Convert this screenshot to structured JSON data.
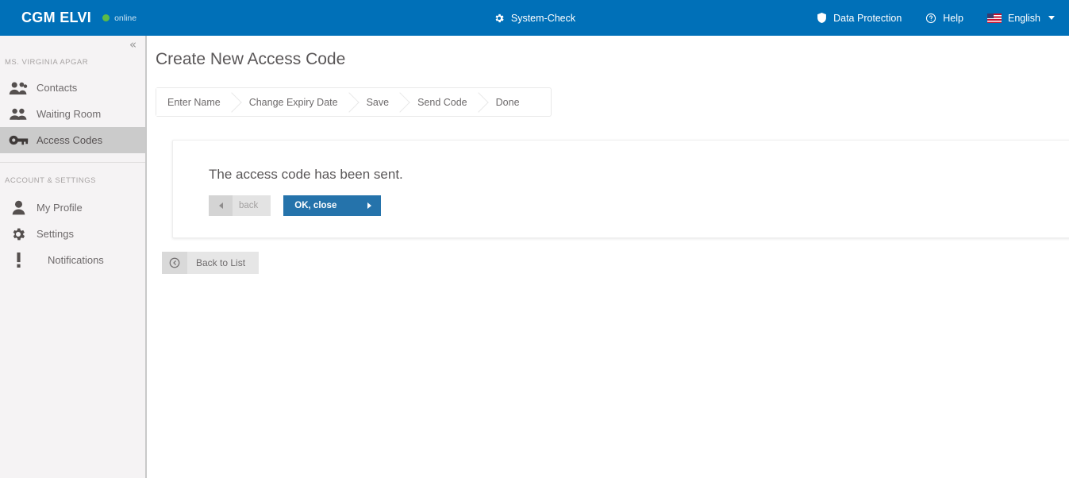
{
  "topbar": {
    "brand": "CGM ELVI",
    "status_label": "online",
    "status_color": "#5dbb46",
    "bar_color": "#0070b8",
    "center_item": {
      "label": "System-Check",
      "icon": "gear-icon"
    },
    "right_items": [
      {
        "label": "Data Protection",
        "icon": "shield-icon"
      },
      {
        "label": "Help",
        "icon": "question-circle-icon"
      },
      {
        "label": "English",
        "icon": "us-flag-icon"
      }
    ]
  },
  "sidebar": {
    "collapse_icon": "«",
    "section_one_label": "MS. VIRGINIA APGAR",
    "section_two_label": "ACCOUNT & SETTINGS",
    "items": [
      {
        "label": "Contacts",
        "icon": "contacts-group-icon",
        "active": false
      },
      {
        "label": "Waiting Room",
        "icon": "waiting-room-people-icon",
        "active": false
      },
      {
        "label": "Access Codes",
        "icon": "key-icon",
        "active": true
      }
    ],
    "account_items": [
      {
        "label": "My Profile",
        "icon": "user-icon"
      },
      {
        "label": "Settings",
        "icon": "gear-icon"
      },
      {
        "label": "Notifications",
        "icon": "exclamation-icon"
      }
    ],
    "active_bg": "#cbcbcb"
  },
  "main": {
    "page_title": "Create New Access Code",
    "steps": [
      {
        "label": "Enter Name"
      },
      {
        "label": "Change Expiry Date"
      },
      {
        "label": "Save"
      },
      {
        "label": "Send Code"
      },
      {
        "label": "Done"
      }
    ],
    "card": {
      "message": "The access code has been sent.",
      "back_button": "back",
      "ok_button": "OK, close",
      "ok_button_color": "#2573ab"
    },
    "back_to_list_button": "Back to List"
  }
}
